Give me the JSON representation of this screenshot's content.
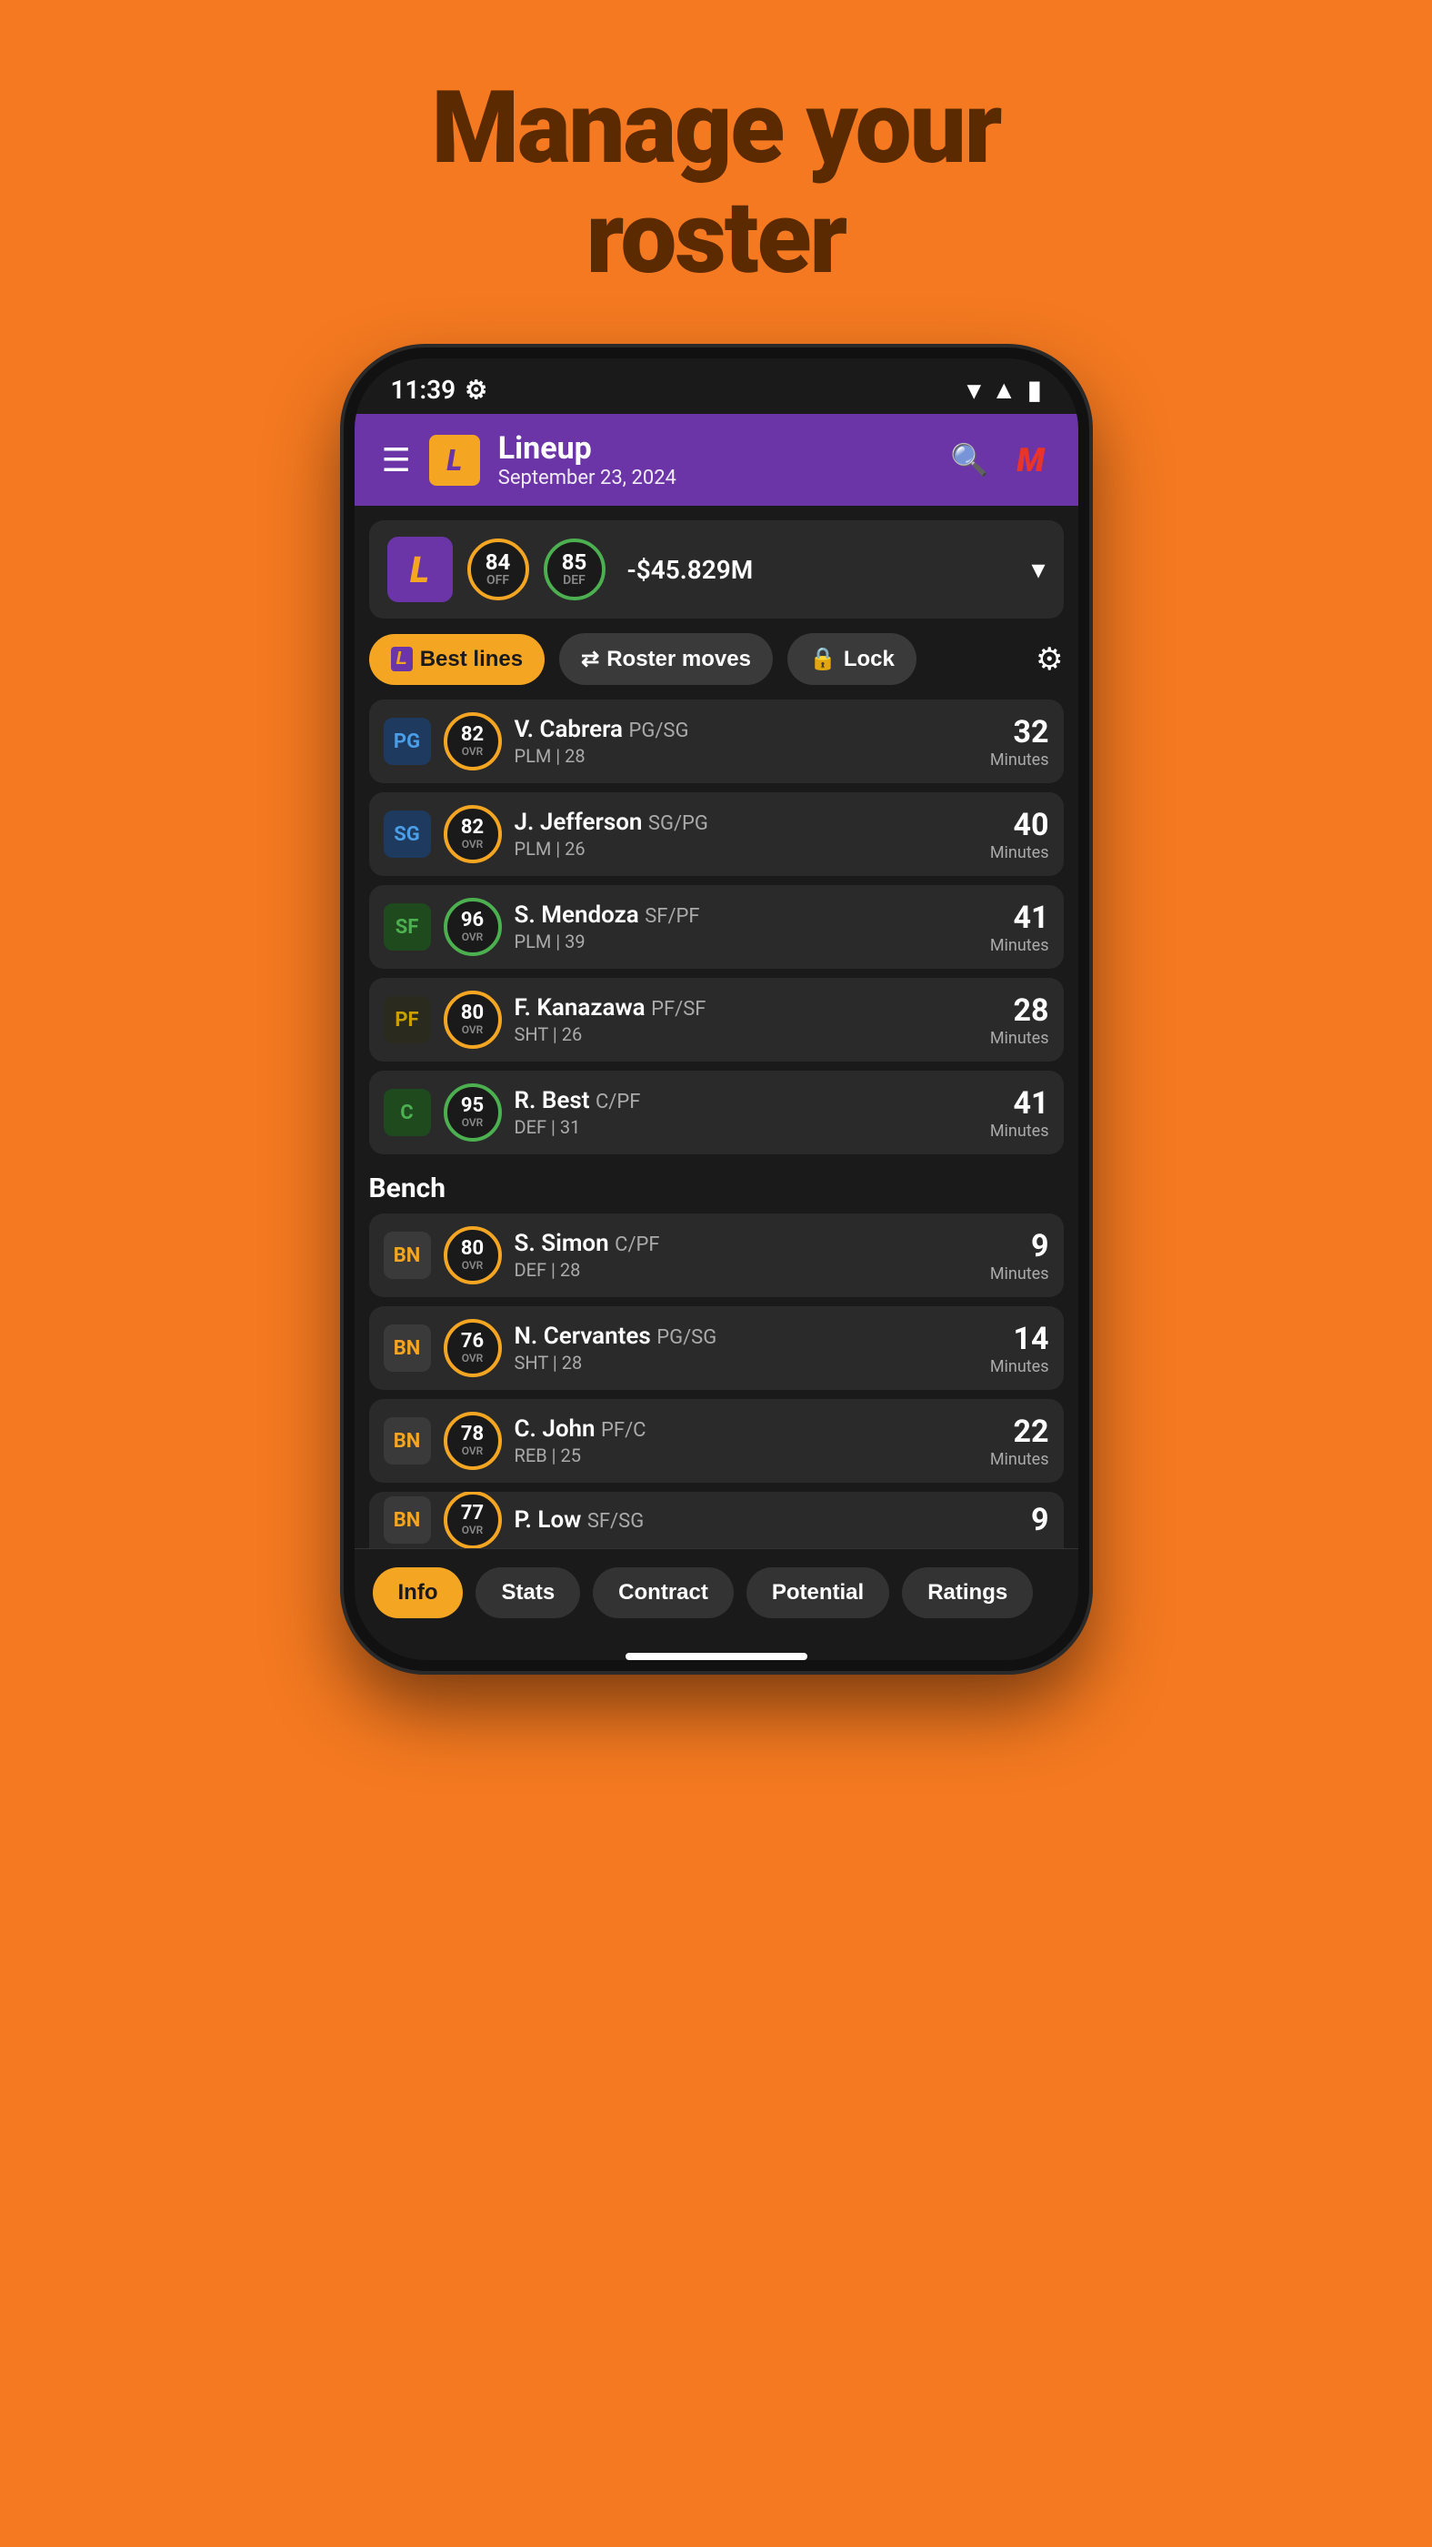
{
  "headline": {
    "line1": "Manage your",
    "line2": "roster"
  },
  "status_bar": {
    "time": "11:39",
    "settings_icon": "⚙",
    "wifi_icon": "▾",
    "signal_icon": "▲",
    "battery_icon": "🔋"
  },
  "header": {
    "menu_icon": "☰",
    "team_logo": "L",
    "title": "Lineup",
    "subtitle": "September 23, 2024",
    "search_icon": "🔍",
    "profile_letter": "M"
  },
  "team_card": {
    "logo": "L",
    "off_rating": "84",
    "off_label": "OFF",
    "def_rating": "85",
    "def_label": "DEF",
    "salary": "-$45.829M",
    "chevron": "▾"
  },
  "actions": {
    "best_lines": "Best lines",
    "roster_moves": "Roster moves",
    "lock": "Lock",
    "gear": "⚙"
  },
  "starters": [
    {
      "position": "PG",
      "ovr": "82",
      "name": "V. Cabrera",
      "pos_detail": "PG/SG",
      "team_detail": "PLM | 28",
      "minutes": "32",
      "ovr_color": "yellow"
    },
    {
      "position": "SG",
      "ovr": "82",
      "name": "J. Jefferson",
      "pos_detail": "SG/PG",
      "team_detail": "PLM | 26",
      "minutes": "40",
      "ovr_color": "yellow"
    },
    {
      "position": "SF",
      "ovr": "96",
      "name": "S. Mendoza",
      "pos_detail": "SF/PF",
      "team_detail": "PLM | 39",
      "minutes": "41",
      "ovr_color": "green"
    },
    {
      "position": "PF",
      "ovr": "80",
      "name": "F. Kanazawa",
      "pos_detail": "PF/SF",
      "team_detail": "SHT | 26",
      "minutes": "28",
      "ovr_color": "yellow"
    },
    {
      "position": "C",
      "ovr": "95",
      "name": "R. Best",
      "pos_detail": "C/PF",
      "team_detail": "DEF | 31",
      "minutes": "41",
      "ovr_color": "green"
    }
  ],
  "bench_label": "Bench",
  "bench": [
    {
      "position": "BN",
      "ovr": "80",
      "name": "S. Simon",
      "pos_detail": "C/PF",
      "team_detail": "DEF | 28",
      "minutes": "9",
      "ovr_color": "yellow"
    },
    {
      "position": "BN",
      "ovr": "76",
      "name": "N. Cervantes",
      "pos_detail": "PG/SG",
      "team_detail": "SHT | 28",
      "minutes": "14",
      "ovr_color": "yellow"
    },
    {
      "position": "BN",
      "ovr": "78",
      "name": "C. John",
      "pos_detail": "PF/C",
      "team_detail": "REB | 25",
      "minutes": "22",
      "ovr_color": "yellow"
    },
    {
      "position": "BN",
      "ovr": "77",
      "name": "P. Low",
      "pos_detail": "SF/SG",
      "team_detail": "",
      "minutes": "9",
      "ovr_color": "yellow"
    }
  ],
  "bottom_nav": {
    "tabs": [
      "Info",
      "Stats",
      "Contract",
      "Potential",
      "Ratings"
    ]
  }
}
